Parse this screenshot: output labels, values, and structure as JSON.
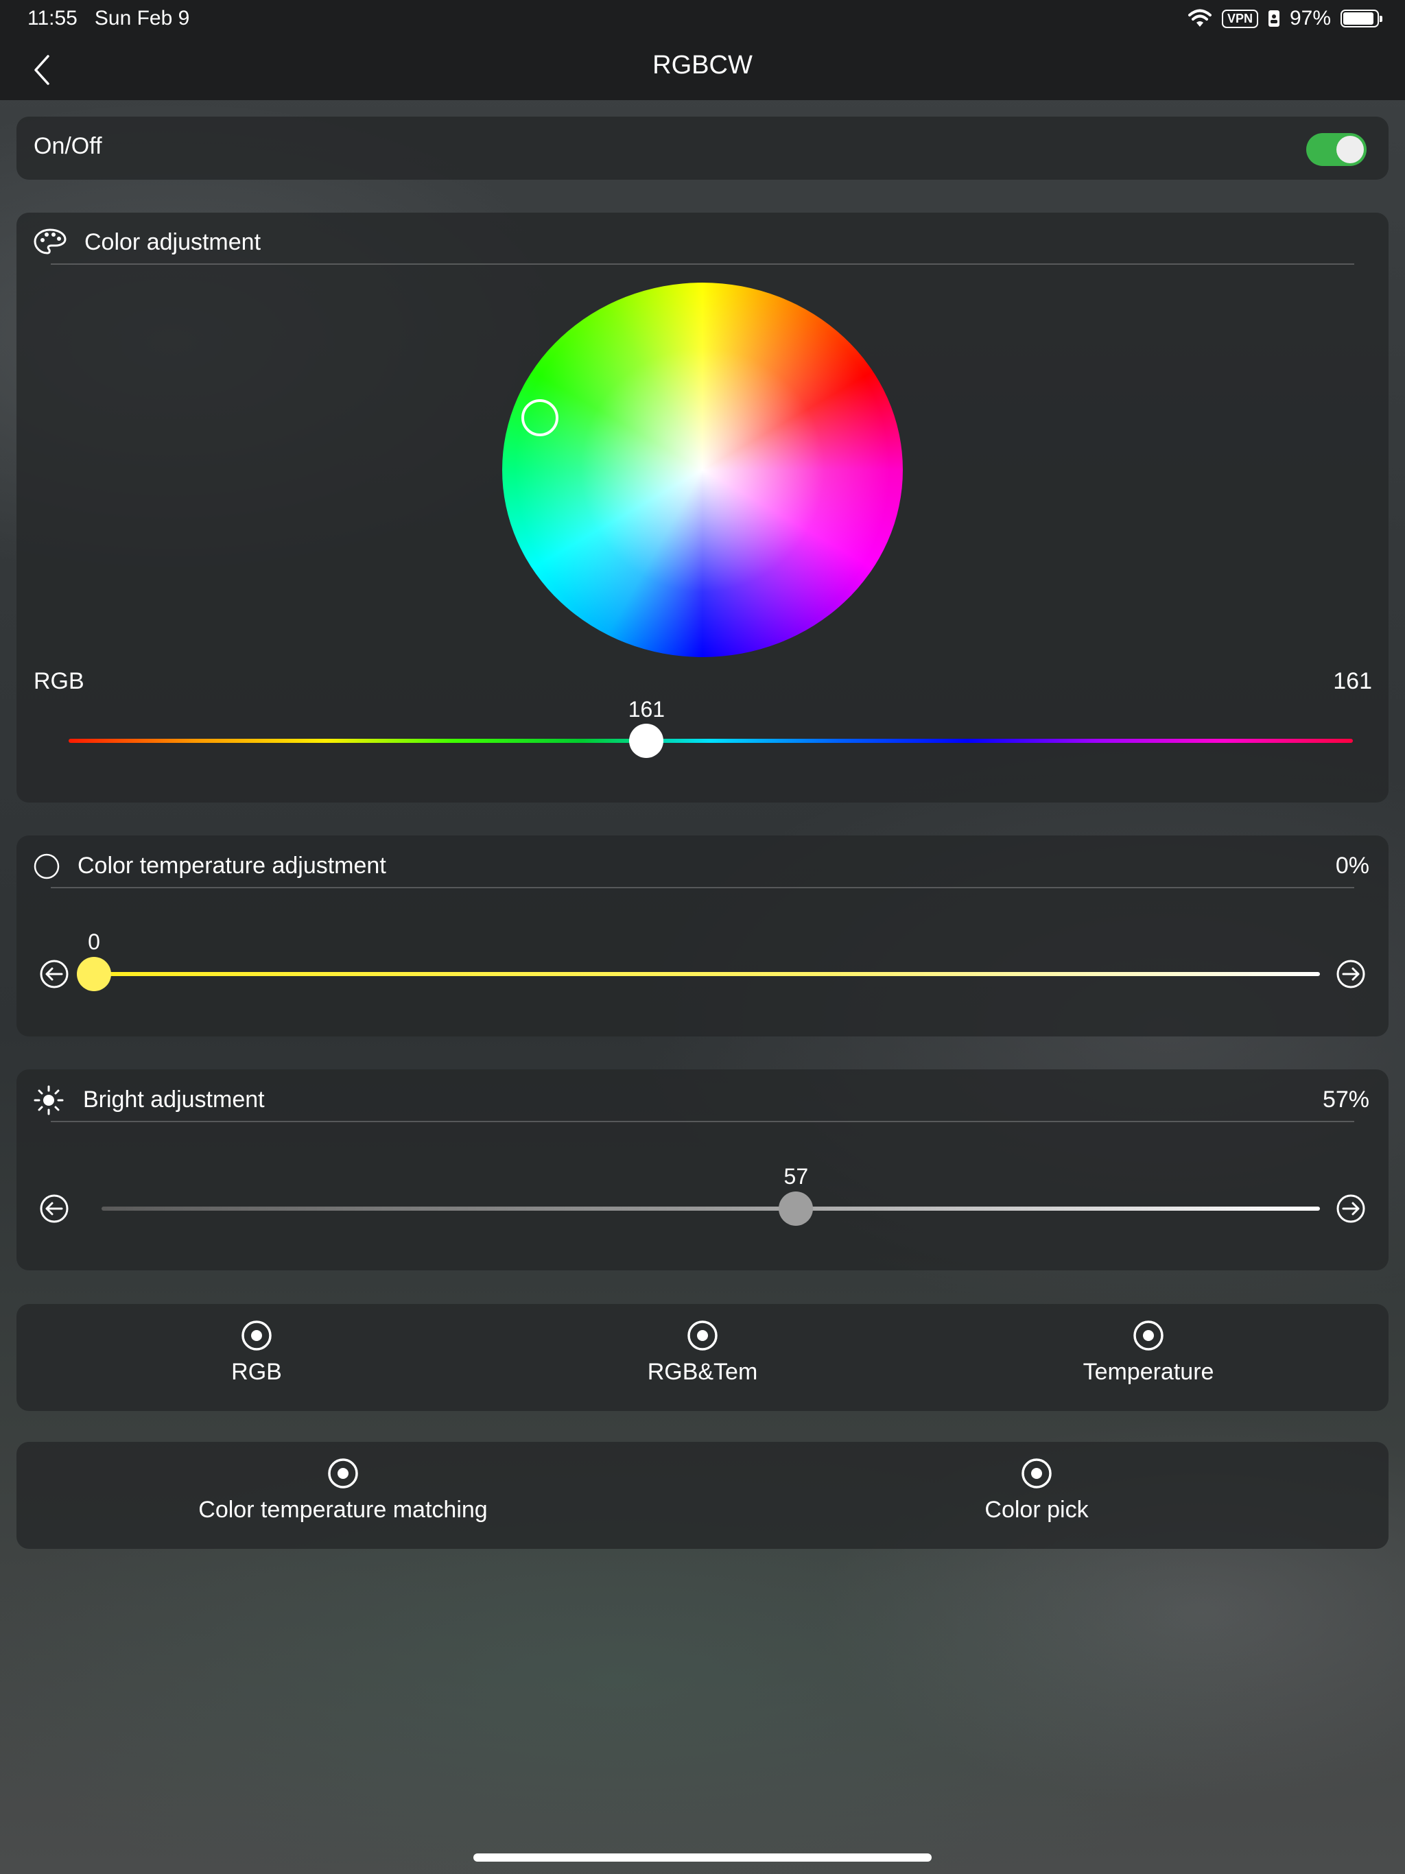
{
  "status": {
    "time": "11:55",
    "date": "Sun Feb 9",
    "vpn": "VPN",
    "battery": "97%"
  },
  "nav": {
    "title": "RGBCW"
  },
  "power": {
    "label": "On/Off",
    "on": true
  },
  "color_adjust": {
    "title": "Color adjustment",
    "rgb_label": "RGB",
    "rgb_value": "161",
    "slider_value_label": "161",
    "slider_fraction": 0.45
  },
  "temp_adjust": {
    "title": "Color temperature adjustment",
    "percent": "0%",
    "slider_value_label": "0",
    "slider_fraction": 0.0
  },
  "bright_adjust": {
    "title": "Bright adjustment",
    "percent": "57%",
    "slider_value_label": "57",
    "slider_fraction": 0.57
  },
  "modes_row1": [
    {
      "label": "RGB"
    },
    {
      "label": "RGB&Tem"
    },
    {
      "label": "Temperature"
    }
  ],
  "modes_row2": [
    {
      "label": "Color temperature matching"
    },
    {
      "label": "Color pick"
    }
  ],
  "colors": {
    "toggle_on": "#3bb44a",
    "temp_thumb": "#ffef5a"
  }
}
